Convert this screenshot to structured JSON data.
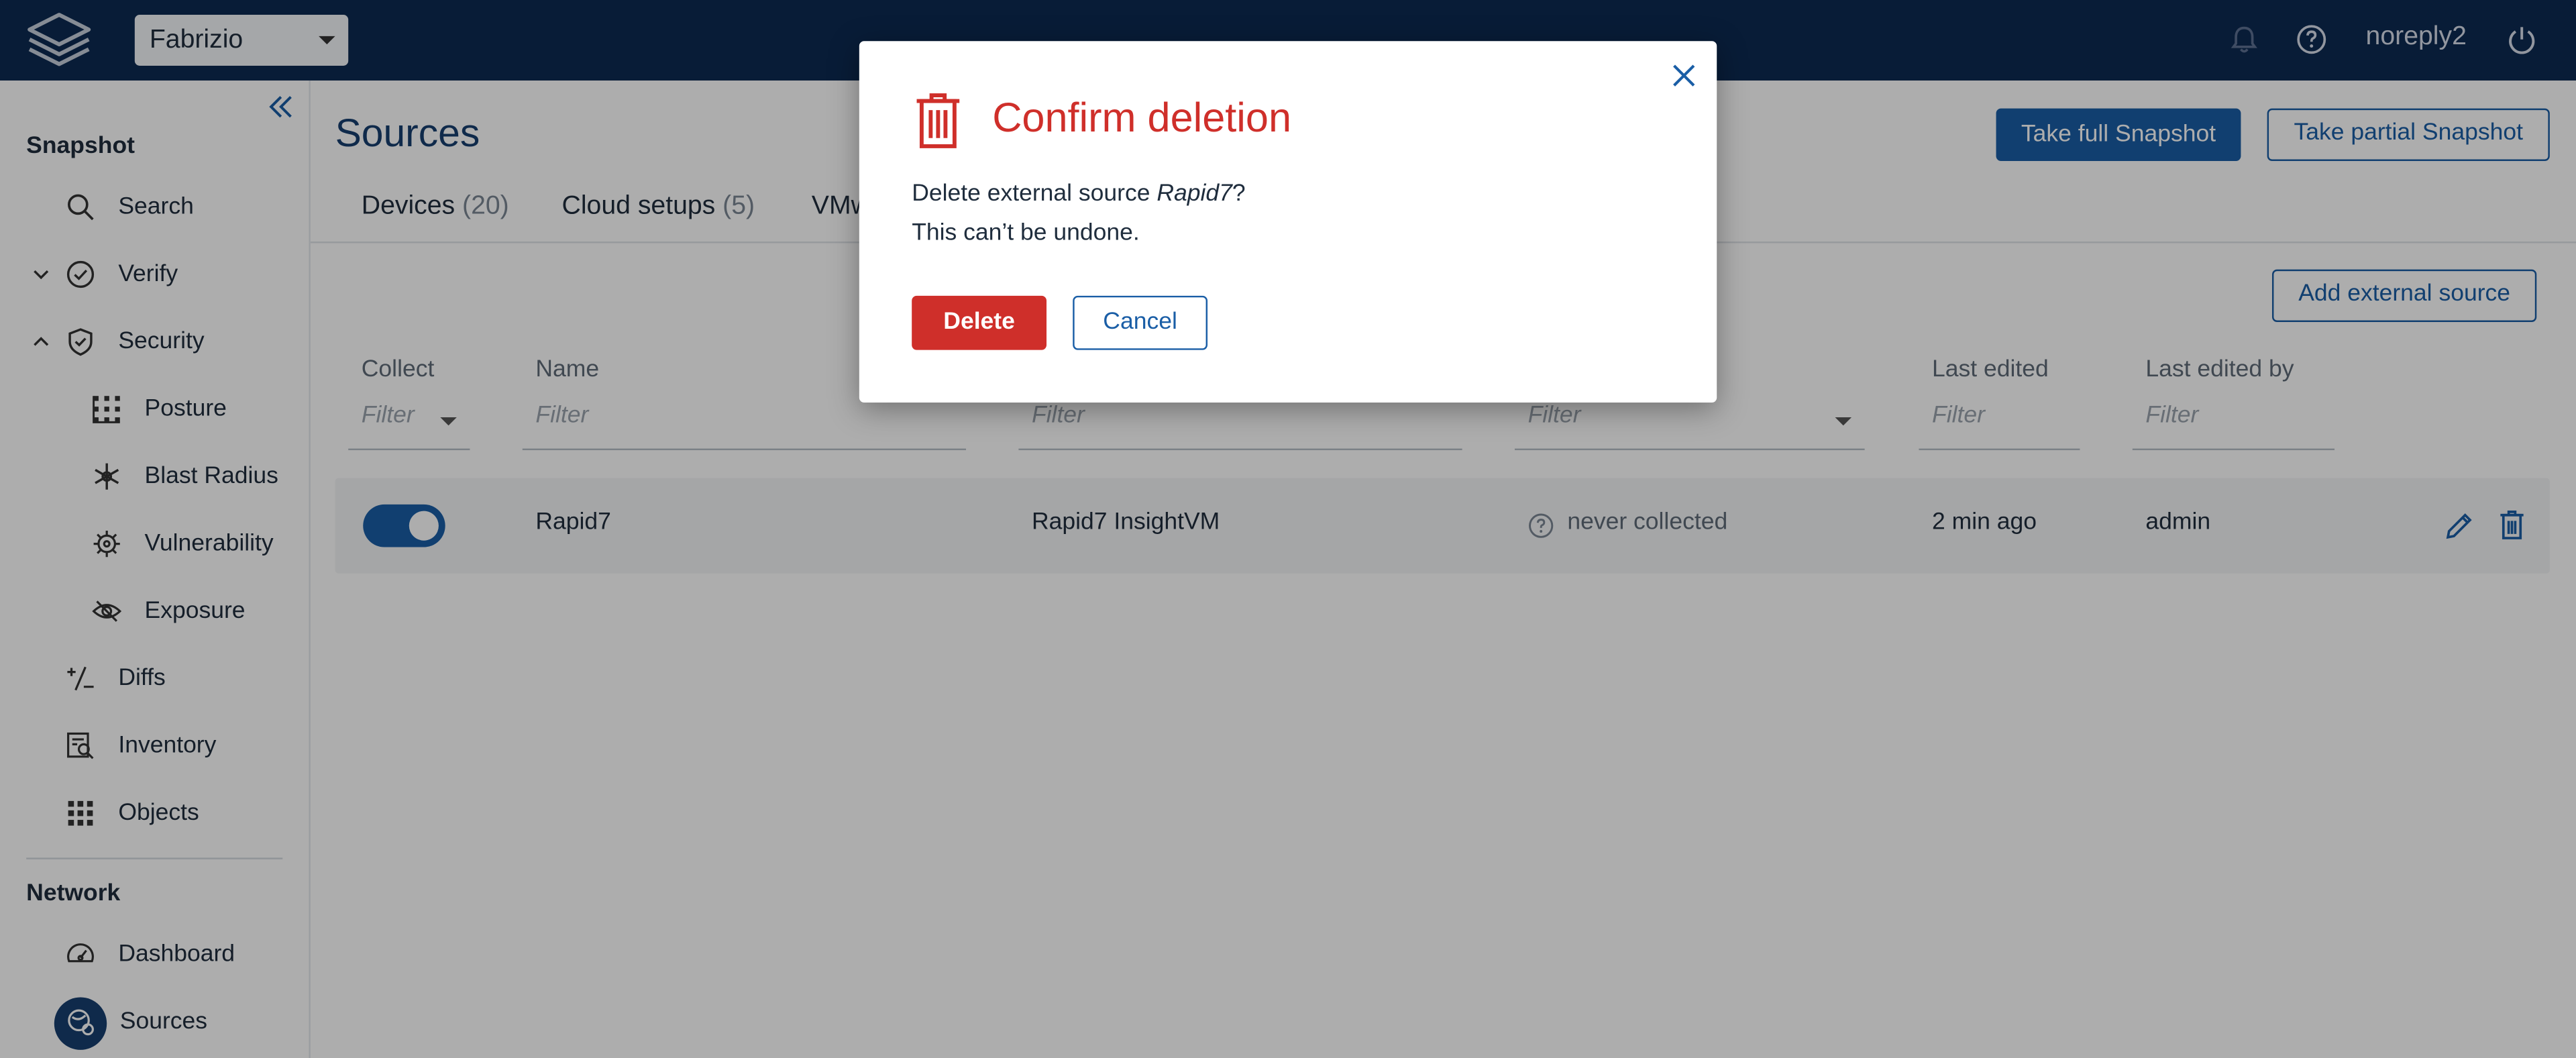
{
  "header": {
    "workspace_select": "Fabrizio",
    "username": "noreply2"
  },
  "sidebar": {
    "snapshot_title": "Snapshot",
    "items": [
      {
        "label": "Search",
        "icon": "search-icon"
      },
      {
        "label": "Verify",
        "icon": "check-circle-icon"
      },
      {
        "label": "Security",
        "icon": "shield-check-icon"
      },
      {
        "label": "Posture",
        "icon": "posture-grid-icon"
      },
      {
        "label": "Blast Radius",
        "icon": "snowflake-icon"
      },
      {
        "label": "Vulnerability",
        "icon": "virus-icon"
      },
      {
        "label": "Exposure",
        "icon": "eye-icon"
      },
      {
        "label": "Diffs",
        "icon": "plus-minus-icon"
      },
      {
        "label": "Inventory",
        "icon": "inventory-icon"
      },
      {
        "label": "Objects",
        "icon": "grid-dots-icon"
      }
    ],
    "network_title": "Network",
    "network_items": [
      {
        "label": "Dashboard",
        "icon": "gauge-icon"
      },
      {
        "label": "Sources",
        "icon": "sources-icon"
      }
    ]
  },
  "main": {
    "title": "Sources",
    "take_full_snapshot": "Take full Snapshot",
    "take_partial_snapshot": "Take partial Snapshot",
    "add_external_source": "Add external source",
    "tabs": [
      {
        "label": "Devices",
        "count": "(20)"
      },
      {
        "label": "Cloud setups",
        "count": "(5)"
      },
      {
        "label": "VMw",
        "count": ""
      }
    ],
    "columns": {
      "collect": "Collect",
      "name": "Name",
      "last_edited": "Last edited",
      "last_edited_by": "Last edited by"
    },
    "filter_placeholder": "Filter",
    "rows": [
      {
        "collect": true,
        "name": "Rapid7",
        "type": "Rapid7 InsightVM",
        "status": "never collected",
        "last_edited": "2 min ago",
        "last_edited_by": "admin"
      }
    ]
  },
  "modal": {
    "title": "Confirm deletion",
    "line1_prefix": "Delete external source ",
    "line1_name": "Rapid7",
    "line1_suffix": "?",
    "line2": "This can’t be undone.",
    "delete_label": "Delete",
    "cancel_label": "Cancel"
  },
  "colors": {
    "topbar": "#0d2a52",
    "primary": "#1a5ea6",
    "danger": "#cf2f2a"
  }
}
